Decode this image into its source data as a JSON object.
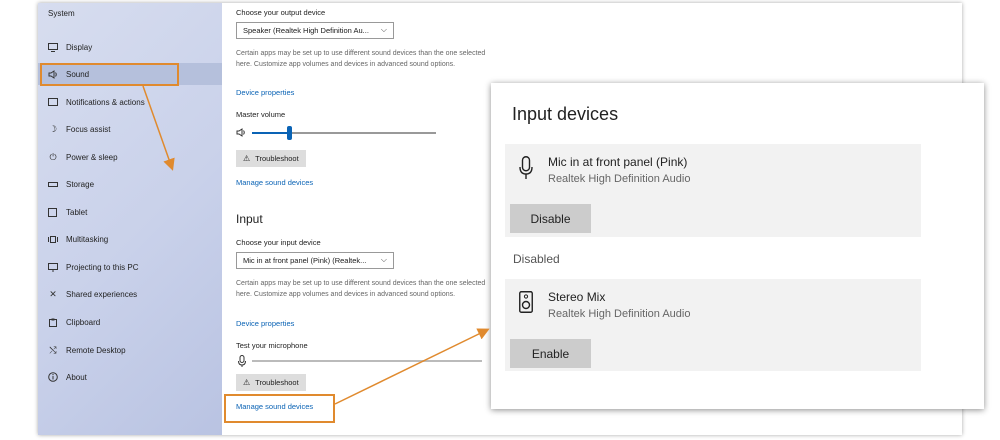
{
  "sidebar": {
    "title": "System",
    "items": [
      {
        "label": "Display",
        "icon": "display-icon"
      },
      {
        "label": "Sound",
        "icon": "speaker-icon"
      },
      {
        "label": "Notifications & actions",
        "icon": "notifications-icon"
      },
      {
        "label": "Focus assist",
        "icon": "moon-icon"
      },
      {
        "label": "Power & sleep",
        "icon": "power-icon"
      },
      {
        "label": "Storage",
        "icon": "storage-icon"
      },
      {
        "label": "Tablet",
        "icon": "tablet-icon"
      },
      {
        "label": "Multitasking",
        "icon": "multitasking-icon"
      },
      {
        "label": "Projecting to this PC",
        "icon": "projecting-icon"
      },
      {
        "label": "Shared experiences",
        "icon": "shared-icon"
      },
      {
        "label": "Clipboard",
        "icon": "clipboard-icon"
      },
      {
        "label": "Remote Desktop",
        "icon": "remote-icon"
      },
      {
        "label": "About",
        "icon": "info-icon"
      }
    ],
    "selected": "Sound"
  },
  "output": {
    "choose_label": "Choose your output device",
    "device": "Speaker (Realtek High Definition Au...",
    "note": "Certain apps may be set up to use different sound devices than the one selected here. Customize app volumes and devices in advanced sound options.",
    "properties_link": "Device properties",
    "master_volume_label": "Master volume",
    "master_volume_value": "20",
    "master_volume_fraction": 0.2,
    "troubleshoot": "Troubleshoot",
    "manage_link": "Manage sound devices"
  },
  "input": {
    "heading": "Input",
    "choose_label": "Choose your input device",
    "device": "Mic in at front panel (Pink) (Realtek...",
    "note": "Certain apps may be set up to use different sound devices than the one selected here. Customize app volumes and devices in advanced sound options.",
    "properties_link": "Device properties",
    "test_label": "Test your microphone",
    "troubleshoot": "Troubleshoot",
    "manage_link": "Manage sound devices"
  },
  "input_devices_panel": {
    "title": "Input devices",
    "devices": [
      {
        "name": "Mic in at front panel (Pink)",
        "sub": "Realtek High Definition Audio",
        "button": "Disable",
        "icon": "microphone-icon"
      }
    ],
    "disabled_heading": "Disabled",
    "disabled_devices": [
      {
        "name": "Stereo Mix",
        "sub": "Realtek High Definition Audio",
        "button": "Enable",
        "icon": "speaker-box-icon"
      }
    ]
  },
  "colors": {
    "accent": "#0a63b5",
    "highlight": "#e08a2e"
  }
}
